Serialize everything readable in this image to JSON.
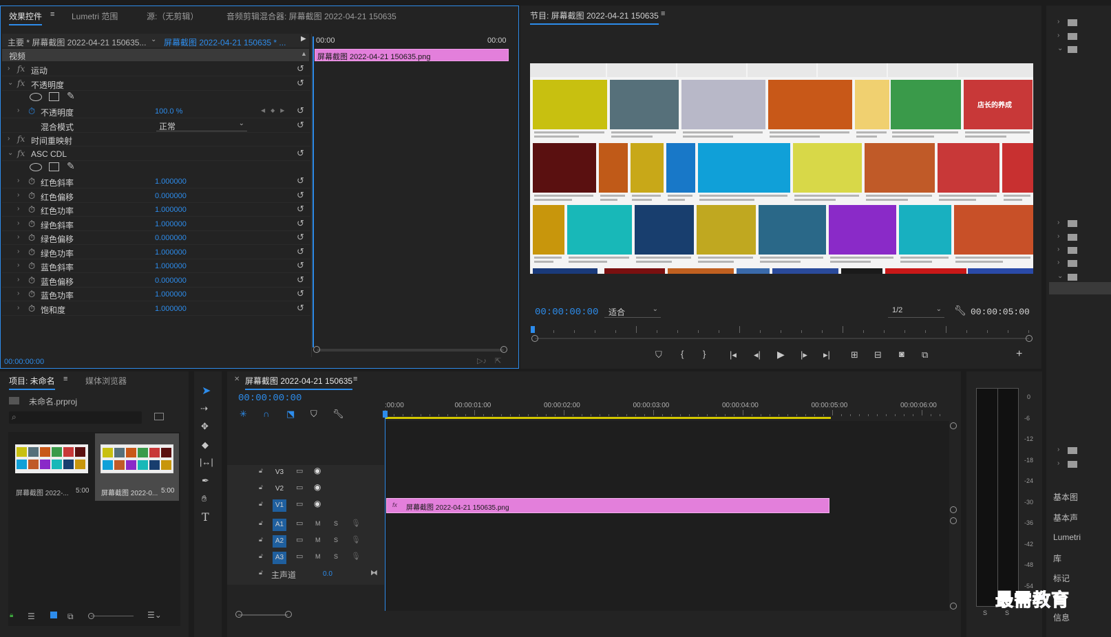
{
  "ec": {
    "tab_effects": "效果控件",
    "tab_lumetri": "Lumetri 范围",
    "tab_source": "源:（无剪辑）",
    "tab_mixer": "音频剪辑混合器: 屏幕截图 2022-04-21 150635",
    "master_clip": "主要 * 屏幕截图 2022-04-21 150635...",
    "seq_clip": "屏幕截图 2022-04-21 150635 * ...",
    "time_start": "00:00",
    "time_end": "00:00",
    "video_section": "视频",
    "clip_bar": "屏幕截图 2022-04-21  150635.png",
    "footer_time": "00:00:00:00",
    "rows": [
      {
        "label": "运动",
        "fx": "fx",
        "chev": "›",
        "val": ""
      },
      {
        "label": "不透明度",
        "fx": "fx",
        "chev": "⌄",
        "val": ""
      },
      {
        "label": "不透明度",
        "fx": "",
        "chev": "›",
        "val": "100.0 %"
      },
      {
        "label": "混合模式",
        "fx": "",
        "chev": "",
        "val": ""
      },
      {
        "label": "时间重映射",
        "fx": "fx",
        "chev": "›",
        "val": ""
      },
      {
        "label": "ASC CDL",
        "fx": "fx",
        "chev": "⌄",
        "val": ""
      },
      {
        "label": "红色斜率",
        "fx": "",
        "chev": "›",
        "val": "1.000000"
      },
      {
        "label": "红色偏移",
        "fx": "",
        "chev": "›",
        "val": "0.000000"
      },
      {
        "label": "红色功率",
        "fx": "",
        "chev": "›",
        "val": "1.000000"
      },
      {
        "label": "绿色斜率",
        "fx": "",
        "chev": "›",
        "val": "1.000000"
      },
      {
        "label": "绿色偏移",
        "fx": "",
        "chev": "›",
        "val": "0.000000"
      },
      {
        "label": "绿色功率",
        "fx": "",
        "chev": "›",
        "val": "1.000000"
      },
      {
        "label": "蓝色斜率",
        "fx": "",
        "chev": "›",
        "val": "1.000000"
      },
      {
        "label": "蓝色偏移",
        "fx": "",
        "chev": "›",
        "val": "0.000000"
      },
      {
        "label": "蓝色功率",
        "fx": "",
        "chev": "›",
        "val": "1.000000"
      },
      {
        "label": "饱和度",
        "fx": "",
        "chev": "›",
        "val": "1.000000"
      }
    ],
    "blend_mode": "正常"
  },
  "pm": {
    "title": "节目: 屏幕截图 2022-04-21 150635",
    "timecode": "00:00:00:00",
    "fit": "适合",
    "quality": "1/2",
    "duration": "00:00:05:00",
    "badge": "店长的养成"
  },
  "project": {
    "tab_project": "项目: 未命名",
    "tab_media": "媒体浏览器",
    "file": "未命名.prproj",
    "items": [
      {
        "name": "屏幕截图 2022-...",
        "dur": "5:00"
      },
      {
        "name": "屏幕截图 2022-0...",
        "dur": "5:00"
      }
    ]
  },
  "tl": {
    "seq_name": "屏幕截图 2022-04-21 150635",
    "timecode": "00:00:00:00",
    "ruler": [
      ":00:00",
      "00:00:01:00",
      "00:00:02:00",
      "00:00:03:00",
      "00:00:04:00",
      "00:00:05:00",
      "00:00:06:00"
    ],
    "tracks": [
      "V3",
      "V2",
      "V1",
      "A1",
      "A2",
      "A3"
    ],
    "master": "主声道",
    "master_val": "0.0",
    "clip": "屏幕截图 2022-04-21  150635.png",
    "m": "M",
    "s": "S"
  },
  "meter": {
    "scale": [
      "0",
      "-6",
      "-12",
      "-18",
      "-24",
      "-30",
      "-36",
      "-42",
      "-48",
      "-54"
    ],
    "s1": "S",
    "s2": "S"
  },
  "right": {
    "items": [
      "基本图",
      "基本声",
      "Lumetri",
      "库",
      "标记",
      "信息"
    ]
  },
  "watermark": "最需教育",
  "colors": {
    "accent": "#2d8ceb",
    "clip": "#e37fdb"
  }
}
